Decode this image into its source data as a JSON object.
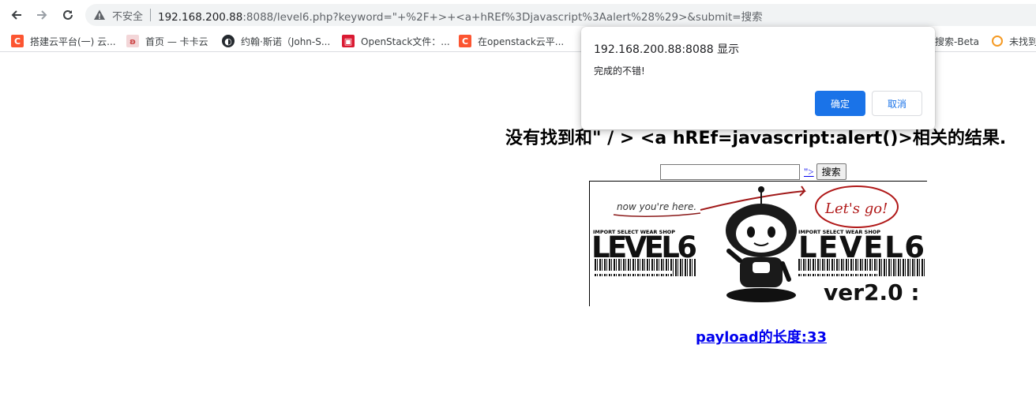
{
  "browser": {
    "security_label": "不安全",
    "url_host": "192.168.200.88",
    "url_rest": ":8088/level6.php?keyword=\"+%2F+>+<a+hREf%3Djavascript%3Aalert%28%29>&submit=搜索"
  },
  "bookmarks": [
    {
      "label": "搭建云平台(一) 云...",
      "icon": "csdn-icon",
      "color": "#fc5531"
    },
    {
      "label": "首页 — 卡卡云",
      "icon": "kakayun-icon",
      "color": "#e8b4b8"
    },
    {
      "label": "约翰·斯诺（John-S...",
      "icon": "github-icon",
      "color": "#24292e"
    },
    {
      "label": "OpenStack文件：...",
      "icon": "openstack-icon",
      "color": "#da1a32"
    },
    {
      "label": "在openstack云平...",
      "icon": "csdn-icon",
      "color": "#fc5531"
    },
    {
      "label": "搜索-Beta",
      "icon": "",
      "color": ""
    },
    {
      "label": "未找到",
      "icon": "loading-icon",
      "color": "#f59a23"
    }
  ],
  "dialog": {
    "title": "192.168.200.88:8088 显示",
    "message": "完成的不错!",
    "ok_label": "确定",
    "cancel_label": "取消"
  },
  "page": {
    "heading": "没有找到和\" / > <a hREf=javascript:alert()>相关的结果.",
    "search_link": "\">",
    "search_button": "搜索",
    "payload_text": "payload的长度:33"
  },
  "banner": {
    "now_text": "now you're here.",
    "lets_go": "Let's go!",
    "shop_text": "IMPORT SELECT WEAR SHOP",
    "level_text": "LEVEL6",
    "ver_text": "ver2.0 :"
  }
}
